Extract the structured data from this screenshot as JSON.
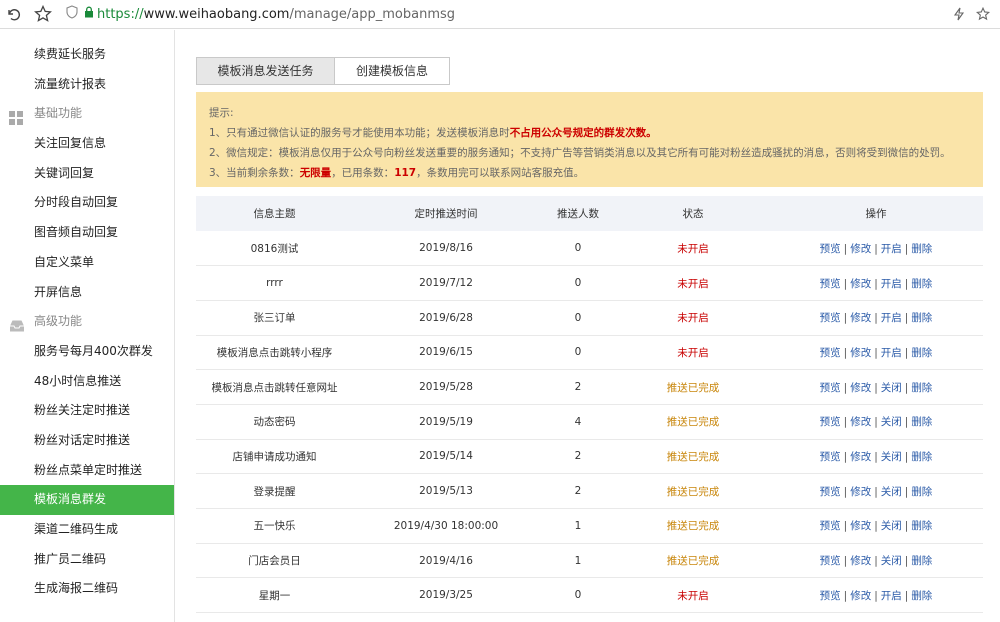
{
  "browser": {
    "url_scheme": "https://",
    "url_host": "www.weihaobang.com",
    "url_path": "/manage/app_mobanmsg"
  },
  "sidebar": {
    "items": [
      {
        "label": "续费延长服务",
        "type": "item"
      },
      {
        "label": "流量统计报表",
        "type": "item"
      },
      {
        "label": "基础功能",
        "type": "group",
        "icon": "grid-icon"
      },
      {
        "label": "关注回复信息",
        "type": "item"
      },
      {
        "label": "关键词回复",
        "type": "item"
      },
      {
        "label": "分时段自动回复",
        "type": "item"
      },
      {
        "label": "图音频自动回复",
        "type": "item"
      },
      {
        "label": "自定义菜单",
        "type": "item"
      },
      {
        "label": "开屏信息",
        "type": "item"
      },
      {
        "label": "高级功能",
        "type": "group",
        "icon": "inbox-icon"
      },
      {
        "label": "服务号每月400次群发",
        "type": "item"
      },
      {
        "label": "48小时信息推送",
        "type": "item"
      },
      {
        "label": "粉丝关注定时推送",
        "type": "item"
      },
      {
        "label": "粉丝对话定时推送",
        "type": "item"
      },
      {
        "label": "粉丝点菜单定时推送",
        "type": "item"
      },
      {
        "label": "模板消息群发",
        "type": "item",
        "active": true
      },
      {
        "label": "渠道二维码生成",
        "type": "item"
      },
      {
        "label": "推广员二维码",
        "type": "item"
      },
      {
        "label": "生成海报二维码",
        "type": "item"
      }
    ]
  },
  "tabs": [
    {
      "label": "模板消息发送任务",
      "active": true
    },
    {
      "label": "创建模板信息",
      "active": false
    }
  ],
  "notice": {
    "title": "提示:",
    "line1_prefix": "1、只有通过微信认证的服务号才能使用本功能；发送模板消息时",
    "line1_red": "不占用公众号规定的群发次数。",
    "line2": "2、微信规定：模板消息仅用于公众号向粉丝发送重要的服务通知；不支持广告等营销类消息以及其它所有可能对粉丝造成骚扰的消息，否则将受到微信的处罚。",
    "line3_prefix": "3、当前剩余条数：",
    "line3_unlimited": "无限量",
    "line3_mid": "，已用条数：",
    "line3_used": "117",
    "line3_suffix": "，条数用完可以联系网站客服充值。"
  },
  "table": {
    "headers": [
      "信息主题",
      "定时推送时间",
      "推送人数",
      "状态",
      "操作"
    ],
    "rows": [
      {
        "subject": "0816测试",
        "time": "2019/8/16",
        "count": "0",
        "status": "未开启",
        "status_type": "off",
        "toggle": "开启"
      },
      {
        "subject": "rrrr",
        "time": "2019/7/12",
        "count": "0",
        "status": "未开启",
        "status_type": "off",
        "toggle": "开启"
      },
      {
        "subject": "张三订单",
        "time": "2019/6/28",
        "count": "0",
        "status": "未开启",
        "status_type": "off",
        "toggle": "开启"
      },
      {
        "subject": "模板消息点击跳转小程序",
        "time": "2019/6/15",
        "count": "0",
        "status": "未开启",
        "status_type": "off",
        "toggle": "开启"
      },
      {
        "subject": "模板消息点击跳转任意网址",
        "time": "2019/5/28",
        "count": "2",
        "status": "推送已完成",
        "status_type": "done",
        "toggle": "关闭"
      },
      {
        "subject": "动态密码",
        "time": "2019/5/19",
        "count": "4",
        "status": "推送已完成",
        "status_type": "done",
        "toggle": "关闭"
      },
      {
        "subject": "店铺申请成功通知",
        "time": "2019/5/14",
        "count": "2",
        "status": "推送已完成",
        "status_type": "done",
        "toggle": "关闭"
      },
      {
        "subject": "登录提醒",
        "time": "2019/5/13",
        "count": "2",
        "status": "推送已完成",
        "status_type": "done",
        "toggle": "关闭"
      },
      {
        "subject": "五一快乐",
        "time": "2019/4/30 18:00:00",
        "count": "1",
        "status": "推送已完成",
        "status_type": "done",
        "toggle": "关闭"
      },
      {
        "subject": "门店会员日",
        "time": "2019/4/16",
        "count": "1",
        "status": "推送已完成",
        "status_type": "done",
        "toggle": "关闭"
      },
      {
        "subject": "星期一",
        "time": "2019/3/25",
        "count": "0",
        "status": "未开启",
        "status_type": "off",
        "toggle": "开启"
      }
    ],
    "op_preview": "预览",
    "op_edit": "修改",
    "op_delete": "删除",
    "op_sep": "|"
  },
  "colors": {
    "accent_green": "#44b549",
    "notice_bg": "#fae4a9",
    "status_off": "#c80000",
    "status_done": "#c8860b",
    "link": "#2b5ba8"
  }
}
